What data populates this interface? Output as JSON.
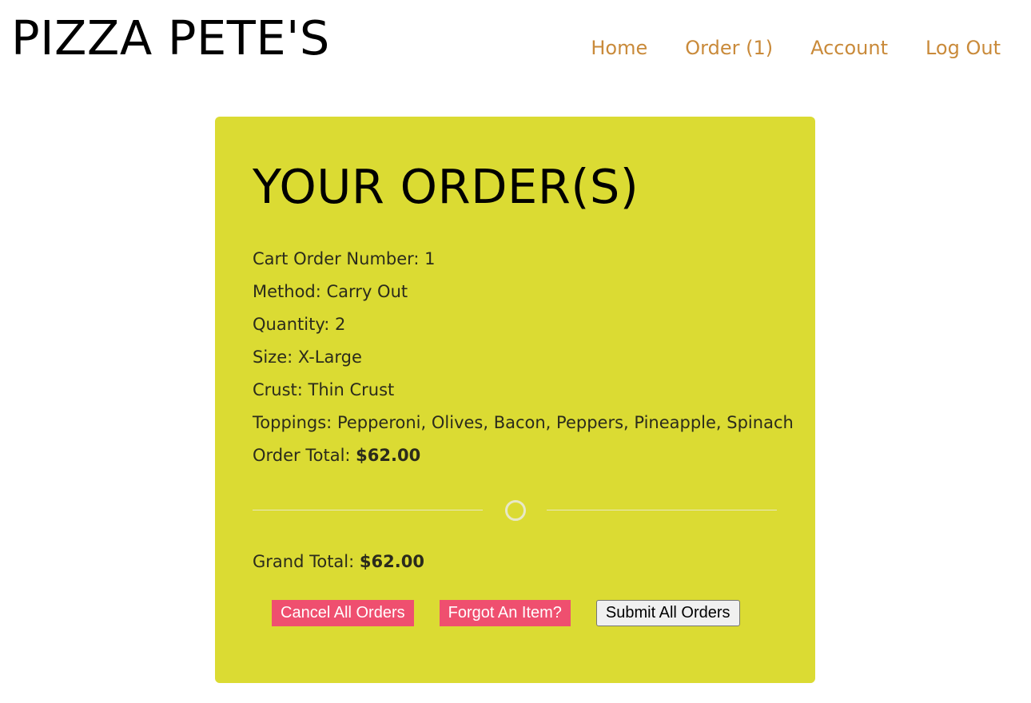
{
  "header": {
    "brand": "PIZZA PETE'S",
    "nav": {
      "home": "Home",
      "order": "Order (1)",
      "account": "Account",
      "logout": "Log Out"
    }
  },
  "colors": {
    "card_background": "#dbdb33",
    "nav_link": "#c98a3a",
    "danger_button": "#ef4f6f"
  },
  "order": {
    "title": "YOUR ORDER(S)",
    "cart_number_label": "Cart Order Number: ",
    "cart_number": "1",
    "method_label": "Method: ",
    "method": "Carry Out",
    "quantity_label": "Quantity: ",
    "quantity": "2",
    "size_label": "Size: ",
    "size": "X-Large",
    "crust_label": "Crust: ",
    "crust": "Thin Crust",
    "toppings_label": "Toppings: ",
    "toppings": "Pepperoni, Olives, Bacon, Peppers, Pineapple, Spinach",
    "total_label": "Order Total: ",
    "total": "$62.00"
  },
  "summary": {
    "grand_total_label": "Grand Total: ",
    "grand_total": "$62.00"
  },
  "actions": {
    "cancel_label": "Cancel All Orders",
    "forgot_label": "Forgot An Item?",
    "submit_label": "Submit All Orders"
  }
}
